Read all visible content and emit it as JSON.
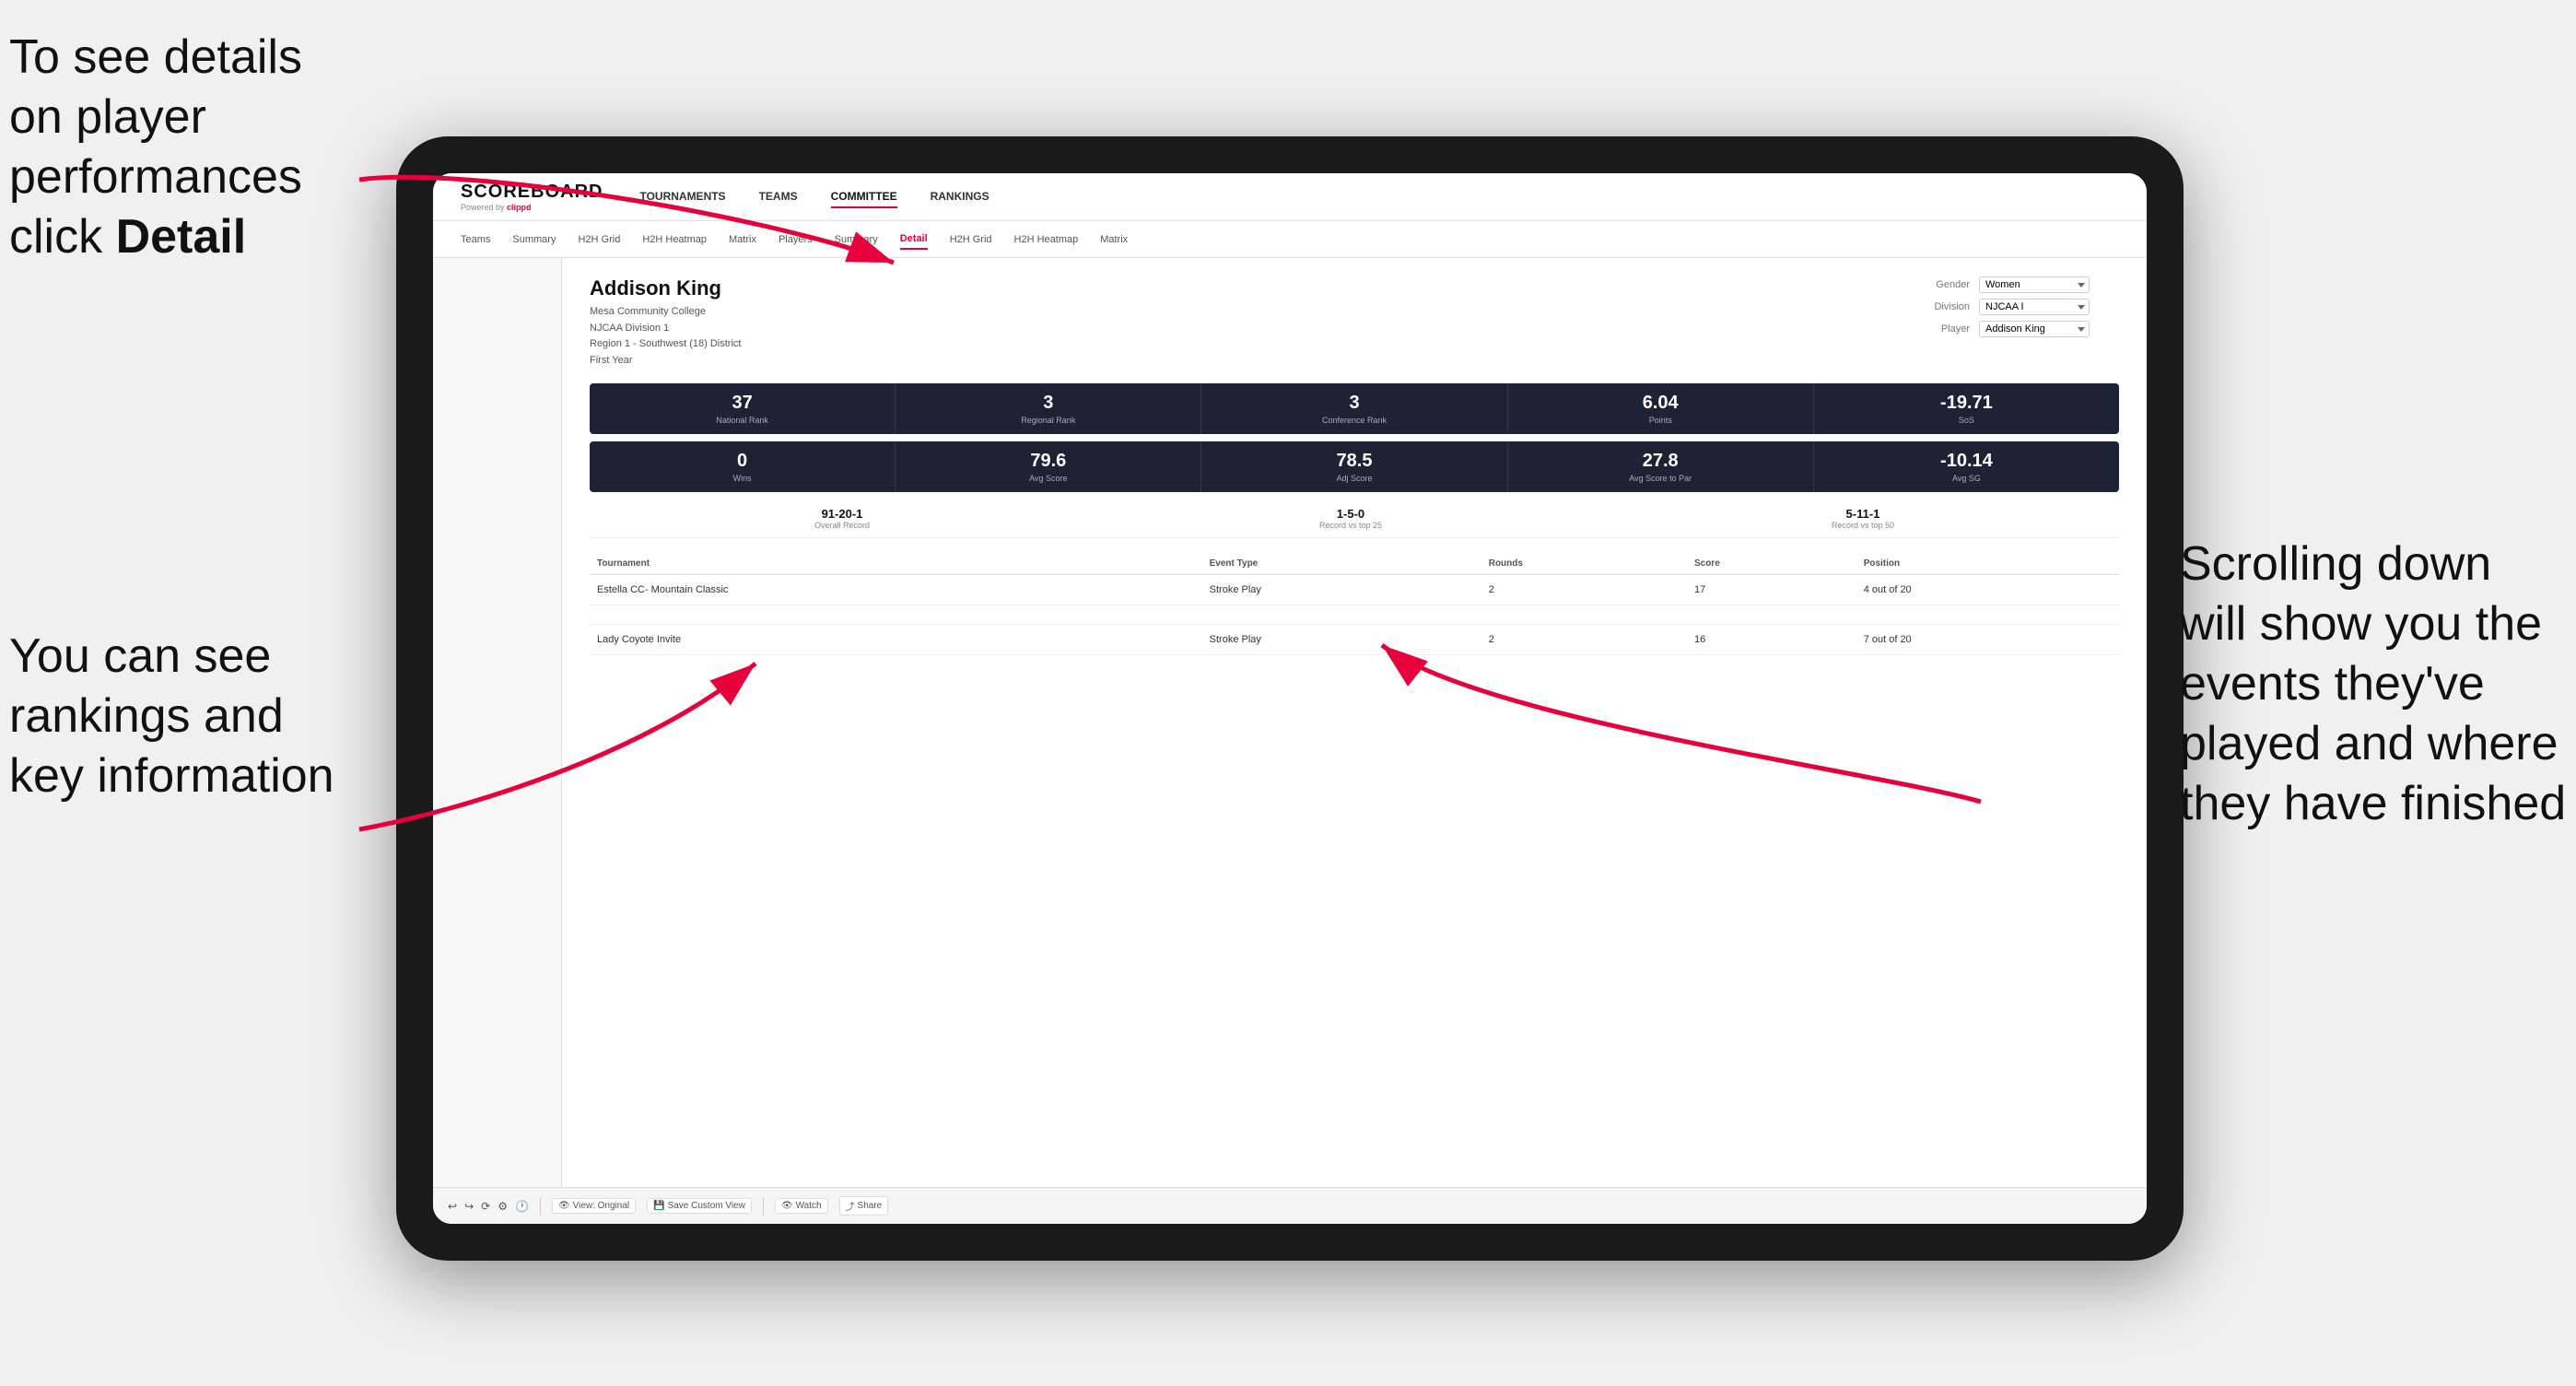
{
  "annotations": {
    "top_left": "To see details on player performances click ",
    "top_left_bold": "Detail",
    "bottom_left_line1": "You can see",
    "bottom_left_line2": "rankings and",
    "bottom_left_line3": "key information",
    "right_line1": "Scrolling down",
    "right_line2": "will show you",
    "right_line3": "the events",
    "right_line4": "they've played",
    "right_line5": "and where they",
    "right_line6": "have finished"
  },
  "nav": {
    "logo": "SCOREBOARD",
    "powered_by": "Powered by clippd",
    "main_items": [
      "TOURNAMENTS",
      "TEAMS",
      "COMMITTEE",
      "RANKINGS"
    ],
    "sub_items": [
      "Teams",
      "Summary",
      "H2H Grid",
      "H2H Heatmap",
      "Matrix",
      "Players",
      "Summary",
      "Detail",
      "H2H Grid",
      "H2H Heatmap",
      "Matrix"
    ]
  },
  "player": {
    "name": "Addison King",
    "college": "Mesa Community College",
    "division": "NJCAA Division 1",
    "region": "Region 1 - Southwest (18) District",
    "year": "First Year",
    "gender_label": "Gender",
    "gender_value": "Women",
    "division_label": "Division",
    "division_value": "NJCAA I",
    "player_label": "Player",
    "player_value": "Addison King"
  },
  "stats_row1": [
    {
      "value": "37",
      "label": "National Rank"
    },
    {
      "value": "3",
      "label": "Regional Rank"
    },
    {
      "value": "3",
      "label": "Conference Rank"
    },
    {
      "value": "6.04",
      "label": "Points"
    },
    {
      "value": "-19.71",
      "label": "SoS"
    }
  ],
  "stats_row2": [
    {
      "value": "0",
      "label": "Wins"
    },
    {
      "value": "79.6",
      "label": "Avg Score"
    },
    {
      "value": "78.5",
      "label": "Adj Score"
    },
    {
      "value": "27.8",
      "label": "Avg Score to Par"
    },
    {
      "value": "-10.14",
      "label": "Avg SG"
    }
  ],
  "records": [
    {
      "value": "91-20-1",
      "label": "Overall Record"
    },
    {
      "value": "1-5-0",
      "label": "Record vs top 25"
    },
    {
      "value": "5-11-1",
      "label": "Record vs top 50"
    }
  ],
  "table": {
    "headers": [
      "Tournament",
      "Event Type",
      "Rounds",
      "Score",
      "Position"
    ],
    "rows": [
      {
        "tournament": "Estella CC- Mountain Classic",
        "event_type": "Stroke Play",
        "rounds": "2",
        "score": "17",
        "position": "4 out of 20"
      },
      {
        "tournament": "Lady Coyote Invite",
        "event_type": "Stroke Play",
        "rounds": "2",
        "score": "16",
        "position": "7 out of 20"
      }
    ]
  },
  "toolbar": {
    "view_label": "View: Original",
    "save_label": "Save Custom View",
    "watch_label": "Watch",
    "share_label": "Share"
  }
}
